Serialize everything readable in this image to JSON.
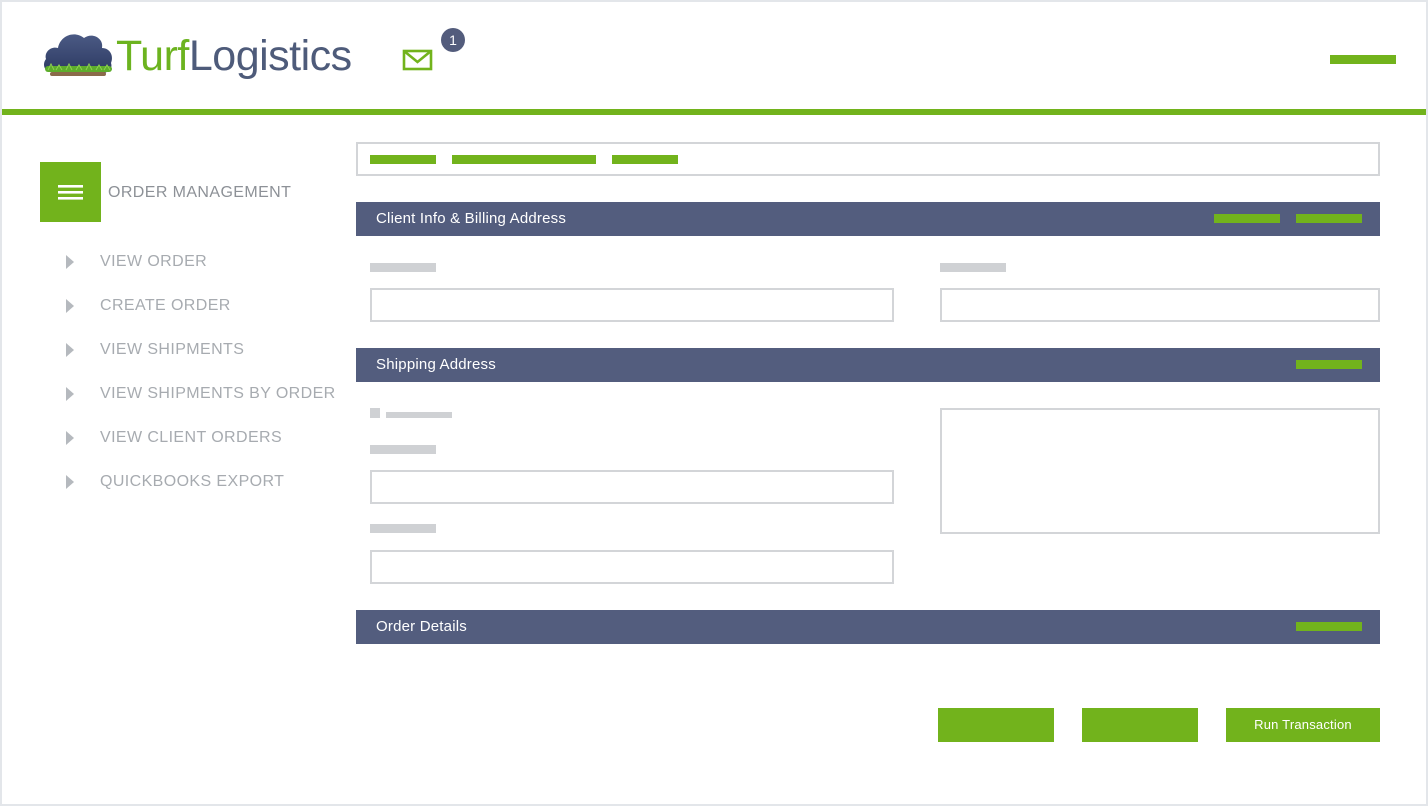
{
  "app": {
    "logo_part1": "Turf",
    "logo_part2": "Logistics"
  },
  "header": {
    "mail_badge": "1",
    "accent_color": "#72b31c",
    "mail_icon": "mail-icon"
  },
  "sidebar": {
    "title": "ORDER MANAGEMENT",
    "menu_icon": "hamburger-icon",
    "items": [
      {
        "label": "VIEW ORDER"
      },
      {
        "label": "CREATE ORDER"
      },
      {
        "label": "VIEW SHIPMENTS"
      },
      {
        "label": "VIEW SHIPMENTS BY ORDER"
      },
      {
        "label": "VIEW CLIENT ORDERS"
      },
      {
        "label": "QUICKBOOKS EXPORT"
      }
    ]
  },
  "sections": {
    "client_info": {
      "title": "Client Info & Billing Address"
    },
    "shipping": {
      "title": "Shipping Address"
    },
    "order_details": {
      "title": "Order Details"
    }
  },
  "actions": {
    "run_transaction": "Run Transaction"
  },
  "colors": {
    "section_bar": "#535d7e",
    "accent": "#72b31c",
    "placeholder_gray": "#cfd1d4"
  }
}
